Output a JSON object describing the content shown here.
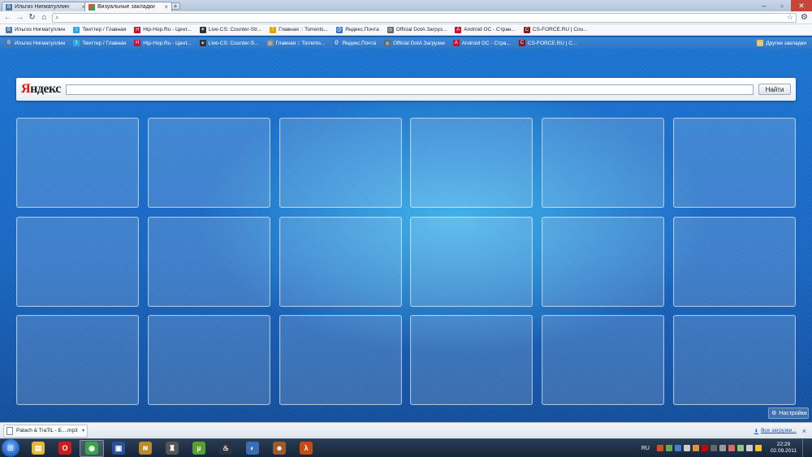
{
  "tabs": [
    {
      "title": "Ильгиз Нигматуллин",
      "active": false,
      "favicon": "vk-icon"
    },
    {
      "title": "Визуальные закладки",
      "active": true,
      "favicon": "grid-icon"
    }
  ],
  "toolbar": {
    "address_value": ""
  },
  "bookmarks_bar": [
    {
      "label": "Ильгиз Нигматуллин",
      "icon": "vk-icon",
      "color": "#4a76a8",
      "glyph": "В"
    },
    {
      "label": "Твиттер / Главная",
      "icon": "twitter-icon",
      "color": "#33a8e0",
      "glyph": "t"
    },
    {
      "label": "Hip-Hop.Ru - Цент...",
      "icon": "hiphop-icon",
      "color": "#c8102e",
      "glyph": "H"
    },
    {
      "label": "Live-CS: Counter-Str...",
      "icon": "cs-icon",
      "color": "#333333",
      "glyph": "✦"
    },
    {
      "label": "Главная :: Torrents...",
      "icon": "torrent-icon",
      "color": "#e9a200",
      "glyph": "T"
    },
    {
      "label": "Яндекс.Почта",
      "icon": "yandex-mail-icon",
      "color": "#2f6fd0",
      "glyph": "@"
    },
    {
      "label": "Official DotA Загруз...",
      "icon": "dota-icon",
      "color": "#666666",
      "glyph": "◎"
    },
    {
      "label": "Android OC - Стран...",
      "icon": "android-icon",
      "color": "#c8102e",
      "glyph": "A"
    },
    {
      "label": "CS-FORCE.RU | Cou...",
      "icon": "csforce-icon",
      "color": "#8b1a1a",
      "glyph": "C"
    }
  ],
  "visual_bookmarks_bar": [
    {
      "label": "Ильгиз Нигматуллин",
      "icon": "vk-icon",
      "color": "#4a76a8",
      "glyph": "В"
    },
    {
      "label": "Твиттер / Главная",
      "icon": "twitter-icon",
      "color": "#33a8e0",
      "glyph": "t"
    },
    {
      "label": "Hip-Hop.Ru - Цент...",
      "icon": "hiphop-icon",
      "color": "#c8102e",
      "glyph": "H"
    },
    {
      "label": "Live-CS: Counter-S...",
      "icon": "cs-icon",
      "color": "#333333",
      "glyph": "✦"
    },
    {
      "label": "Главная :: Torrents...",
      "icon": "torrent-icon",
      "color": "#888888",
      "glyph": "◎"
    },
    {
      "label": "Яндекс.Почта",
      "icon": "yandex-mail-icon",
      "color": "#2f6fd0",
      "glyph": "@"
    },
    {
      "label": "Official DotA Загрузки",
      "icon": "dota-icon",
      "color": "#666666",
      "glyph": "◎"
    },
    {
      "label": "Android OC - Стра...",
      "icon": "android-icon",
      "color": "#c8102e",
      "glyph": "A"
    },
    {
      "label": "CS-FORCE.RU | C...",
      "icon": "csforce-icon",
      "color": "#8b1a1a",
      "glyph": "C"
    }
  ],
  "other_bookmarks": {
    "label": "Другие закладки",
    "icon": "folder-icon"
  },
  "other_bookmarks_top": {
    "label": "Другие закладки",
    "icon": "folder-icon"
  },
  "yandex": {
    "logo_first": "Я",
    "logo_rest": "ндекс",
    "search_value": "",
    "search_button": "Найти"
  },
  "tiles": {
    "rows": 3,
    "cols": 6
  },
  "settings_label": "Настройки",
  "downloads": {
    "item_label": "Palach & TraTiL - Б....mp3",
    "all_label": "Все загрузки..."
  },
  "taskbar": {
    "apps": [
      {
        "name": "explorer-icon",
        "color": "#e8b930",
        "glyph": "▤",
        "active": false
      },
      {
        "name": "opera-icon",
        "color": "#d01a1a",
        "glyph": "O",
        "active": false
      },
      {
        "name": "chrome-icon",
        "color": "#3aa34a",
        "glyph": "◉",
        "active": true
      },
      {
        "name": "save-disk-icon",
        "color": "#2c4f9e",
        "glyph": "▣",
        "active": false
      },
      {
        "name": "winamp-icon",
        "color": "#b98a2a",
        "glyph": "≋",
        "active": false
      },
      {
        "name": "dota-app-icon",
        "color": "#555555",
        "glyph": "♜",
        "active": false
      },
      {
        "name": "utorrent-icon",
        "color": "#5aa02c",
        "glyph": "µ",
        "active": false
      },
      {
        "name": "steam-icon",
        "color": "#2b3340",
        "glyph": "♨",
        "active": false
      },
      {
        "name": "media-icon",
        "color": "#3a6db5",
        "glyph": "◐",
        "active": false
      },
      {
        "name": "bear-icon",
        "color": "#9b5b2a",
        "glyph": "☻",
        "active": false
      },
      {
        "name": "halflife-icon",
        "color": "#c84b12",
        "glyph": "λ",
        "active": false
      }
    ],
    "lang": "RU",
    "time": "22:29",
    "date": "02.09.2011",
    "tray_colors": [
      "#d94c1a",
      "#6aa84f",
      "#3d85c6",
      "#cccccc",
      "#e69138",
      "#cc0000",
      "#666666",
      "#999999",
      "#e06666",
      "#93c47d",
      "#cccccc",
      "#f1c232"
    ]
  }
}
